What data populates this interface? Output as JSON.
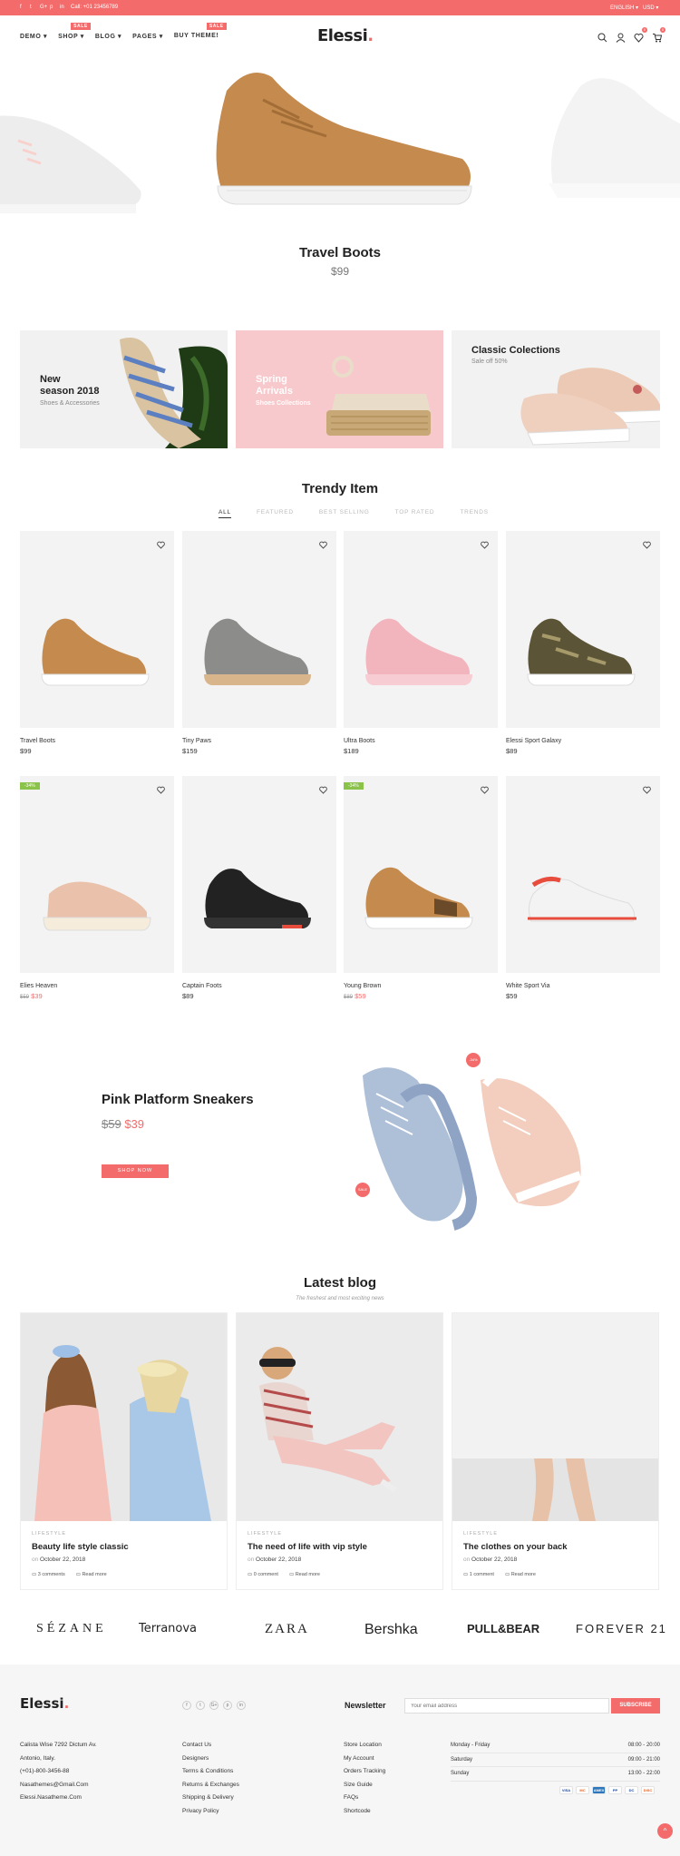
{
  "topbar": {
    "social": [
      "f",
      "t",
      "G+",
      "p",
      "in"
    ],
    "phone": "Call: +01 23456789",
    "language": "ENGLISH",
    "currency": "USD"
  },
  "header": {
    "logo": "Elessi",
    "logo_dot": ".",
    "nav": [
      {
        "label": "DEMO"
      },
      {
        "label": "SHOP",
        "badge": "SALE"
      },
      {
        "label": "BLOG"
      },
      {
        "label": "PAGES"
      },
      {
        "label": "BUY THEME!",
        "badge": "SALE"
      }
    ],
    "wishlist_count": "0",
    "cart_count": "0"
  },
  "hero": {
    "title": "Travel Boots",
    "price": "$99"
  },
  "banners": [
    {
      "title_l1": "New",
      "title_l2": "season 2018",
      "subtitle": "Shoes & Accessories"
    },
    {
      "title_l1": "Spring",
      "title_l2": "Arrivals",
      "subtitle": "Shoes Collections"
    },
    {
      "title_l1": "Classic Colections",
      "title_l2": "",
      "subtitle": "Sale off 50%"
    }
  ],
  "trendy": {
    "title": "Trendy Item",
    "tabs": [
      "ALL",
      "FEATURED",
      "BEST SELLING",
      "TOP RATED",
      "TRENDS"
    ],
    "products": [
      {
        "name": "Travel Boots",
        "price": "$99"
      },
      {
        "name": "Tiny Paws",
        "price": "$159"
      },
      {
        "name": "Ultra Boots",
        "price": "$189"
      },
      {
        "name": "Elessi Sport Galaxy",
        "price": "$89"
      },
      {
        "name": "Elies Heaven",
        "old": "$59",
        "new": "$39",
        "sale": "-34%"
      },
      {
        "name": "Captain Foots",
        "price": "$89"
      },
      {
        "name": "Young Brown",
        "old": "$89",
        "new": "$59",
        "sale": "-34%"
      },
      {
        "name": "White Sport Via",
        "price": "$59"
      }
    ]
  },
  "promo": {
    "title": "Pink Platform Sneakers",
    "old": "$59",
    "new": "$39",
    "button": "SHOP NOW",
    "badge1": "-34%",
    "badge2": "SALE"
  },
  "blog": {
    "title": "Latest blog",
    "subtitle": "The freshest and most exciting news",
    "posts": [
      {
        "cat": "LIFESTYLE",
        "title": "Beauty life style classic",
        "on": "on",
        "date": "October 22, 2018",
        "comments": "3 comments",
        "more": "Read more"
      },
      {
        "cat": "LIFESTYLE",
        "title": "The need of life with vip style",
        "on": "on",
        "date": "October 22, 2018",
        "comments": "0 comment",
        "more": "Read more"
      },
      {
        "cat": "LIFESTYLE",
        "title": "The clothes on your back",
        "on": "on",
        "date": "October 22, 2018",
        "comments": "1 comment",
        "more": "Read more"
      }
    ]
  },
  "brands": [
    "SÉZANE",
    "Terranova",
    "ZARA",
    "Bershka",
    "PULL&BEAR",
    "FOREVER 21"
  ],
  "footer": {
    "logo": "Elessi",
    "logo_dot": ".",
    "social": [
      "f",
      "t",
      "G+",
      "p",
      "in"
    ],
    "newsletter_title": "Newsletter",
    "email_placeholder": "Your email address",
    "subscribe": "SUBSCRIBE",
    "contact": [
      "Calista Wise 7292 Dictum Av.",
      "Antonio, Italy.",
      "(+01)-800-3456-88",
      "Nasathemes@Gmail.Com",
      "Elessi.Nasatheme.Com"
    ],
    "links1": [
      "Contact Us",
      "Designers",
      "Terms & Conditions",
      "Returns & Exchanges",
      "Shipping & Delivery",
      "Privacy Policy"
    ],
    "links2": [
      "Store Location",
      "My Account",
      "Orders Tracking",
      "Size Guide",
      "FAQs",
      "Shortcode"
    ],
    "hours": [
      {
        "day": "Monday - Friday",
        "time": "08:00 - 20:00"
      },
      {
        "day": "Saturday",
        "time": "09:00 - 21:00"
      },
      {
        "day": "Sunday",
        "time": "13:00 - 22:00"
      }
    ],
    "payments": [
      "VISA",
      "MC",
      "AMEX",
      "PP",
      "DC",
      "DISC"
    ]
  },
  "colors": {
    "accent": "#f46b6b",
    "sale_green": "#8bc34a"
  }
}
